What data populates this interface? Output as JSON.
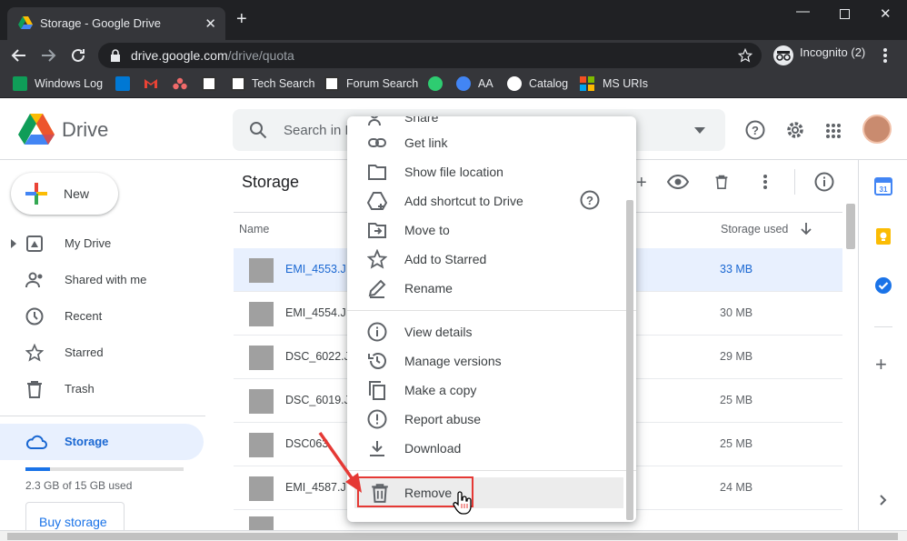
{
  "browser": {
    "tab_title": "Storage - Google Drive",
    "tab_close": "✕",
    "new_tab": "+",
    "url_host": "drive.google.com",
    "url_path": "/drive/quota",
    "profile_label": "Incognito (2)"
  },
  "bookmarks": [
    {
      "label": "Windows Log",
      "icon_color": "#0f9d58"
    },
    {
      "label": "",
      "icon_color": "#0078d4"
    },
    {
      "label": "",
      "icon_color": "#ea4335"
    },
    {
      "label": "",
      "icon_color": "#f06a6a"
    },
    {
      "label": "",
      "icon_color": "#ffffff"
    },
    {
      "label": "Tech Search",
      "icon_color": "#ffffff"
    },
    {
      "label": "Forum Search",
      "icon_color": "#ffffff"
    },
    {
      "label": "",
      "icon_color": "#2ecc71"
    },
    {
      "label": "AA",
      "icon_color": "#4285f4"
    },
    {
      "label": "Catalog",
      "icon_color": "#ffffff"
    },
    {
      "label": "MS URIs",
      "icon_color": "#f25022"
    }
  ],
  "drive": {
    "app_name": "Drive",
    "search_placeholder": "Search in Drive",
    "new_button": "New",
    "nav": [
      {
        "label": "My Drive",
        "icon": "my-drive-icon"
      },
      {
        "label": "Shared with me",
        "icon": "people-icon"
      },
      {
        "label": "Recent",
        "icon": "clock-icon"
      },
      {
        "label": "Starred",
        "icon": "star-icon"
      },
      {
        "label": "Trash",
        "icon": "trash-icon"
      }
    ],
    "storage_nav": "Storage",
    "quota_text": "2.3 GB of 15 GB used",
    "quota_fraction": 0.153,
    "buy_storage": "Buy storage",
    "page_title": "Storage",
    "col_name": "Name",
    "col_storage": "Storage used",
    "files": [
      {
        "name": "EMI_4553.J",
        "size": "33 MB",
        "selected": true
      },
      {
        "name": "EMI_4554.J",
        "size": "30 MB",
        "selected": false
      },
      {
        "name": "DSC_6022.J",
        "size": "29 MB",
        "selected": false
      },
      {
        "name": "DSC_6019.J",
        "size": "25 MB",
        "selected": false
      },
      {
        "name": "DSC063",
        "size": "25 MB",
        "selected": false
      },
      {
        "name": "EMI_4587.J",
        "size": "24 MB",
        "selected": false
      }
    ]
  },
  "context_menu": {
    "items": [
      {
        "label": "Share",
        "icon": "share-icon"
      },
      {
        "label": "Get link",
        "icon": "link-icon"
      },
      {
        "label": "Show file location",
        "icon": "folder-icon"
      },
      {
        "label": "Add shortcut to Drive",
        "icon": "add-shortcut-icon"
      },
      {
        "label": "Move to",
        "icon": "move-to-icon"
      },
      {
        "label": "Add to Starred",
        "icon": "star-icon"
      },
      {
        "label": "Rename",
        "icon": "pencil-icon"
      },
      {
        "label": "View details",
        "icon": "info-icon"
      },
      {
        "label": "Manage versions",
        "icon": "history-icon"
      },
      {
        "label": "Make a copy",
        "icon": "copy-icon"
      },
      {
        "label": "Report abuse",
        "icon": "alert-icon"
      },
      {
        "label": "Download",
        "icon": "download-icon"
      },
      {
        "label": "Remove",
        "icon": "trash-icon"
      }
    ]
  },
  "colors": {
    "accent": "#1a73e8",
    "highlight": "#e53935"
  }
}
